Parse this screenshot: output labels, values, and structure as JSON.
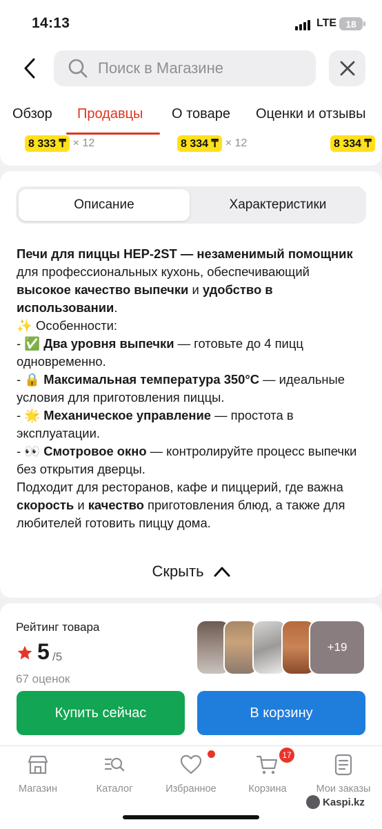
{
  "status": {
    "time": "14:13",
    "network": "LTE",
    "battery": "18"
  },
  "search": {
    "placeholder": "Поиск в Магазине"
  },
  "tabs": [
    "Обзор",
    "Продавцы",
    "О товаре",
    "Оценки и отзывы"
  ],
  "offers": [
    {
      "price": "8 333 ₸",
      "mult": "× 12"
    },
    {
      "price": "8 334 ₸",
      "mult": "× 12"
    },
    {
      "price": "8 334 ₸",
      "mult": ""
    }
  ],
  "segment": {
    "left": "Описание",
    "right": "Характеристики"
  },
  "description": {
    "p1_b1": "Печи для пиццы HEP-2ST — незаменимый помощник",
    "p1_t1": " для профессиональных кухонь, обеспечивающий ",
    "p1_b2": "высокое качество выпечки",
    "p1_t2": " и ",
    "p1_b3": "удобство в использовании",
    "p1_t3": ".",
    "features": "✨ Особенности:",
    "f1_prefix": "- ✅ ",
    "f1_b": "Два уровня выпечки",
    "f1_t": " — готовьте до 4 пицц одновременно.",
    "f2_prefix": "- 🔒 ",
    "f2_b": "Максимальная температура 350°C",
    "f2_t": " — идеальные условия для приготовления пиццы.",
    "f3_prefix": "- 🌟 ",
    "f3_b": "Механическое управление",
    "f3_t": " — простота в эксплуатации.",
    "f4_prefix": "- 👀 ",
    "f4_b": "Смотровое окно",
    "f4_t": " — контролируйте процесс выпечки без открытия дверцы.",
    "c_t1": "Подходит для ресторанов, кафе и пиццерий, где важна ",
    "c_b1": "скорость",
    "c_t2": " и ",
    "c_b2": "качество",
    "c_t3": " приготовления блюд, а также для любителей готовить пиццу дома."
  },
  "hide_label": "Скрыть",
  "rating": {
    "title": "Рейтинг товара",
    "score": "5",
    "max": "/5",
    "count": "67 оценок",
    "more_photos": "+19"
  },
  "buttons": {
    "buy": "Купить сейчас",
    "cart": "В корзину"
  },
  "nav": [
    {
      "label": "Магазин",
      "icon": "shop-icon"
    },
    {
      "label": "Каталог",
      "icon": "catalog-search-icon"
    },
    {
      "label": "Избранное",
      "icon": "heart-icon"
    },
    {
      "label": "Корзина",
      "icon": "cart-icon",
      "badge": "17"
    },
    {
      "label": "Мои заказы",
      "icon": "orders-icon"
    }
  ],
  "watermark": "Kaspi.kz",
  "colors": {
    "accent": "#e0341f",
    "buy": "#12a553",
    "cart": "#1f7ddc",
    "price_chip": "#ffe01b"
  }
}
